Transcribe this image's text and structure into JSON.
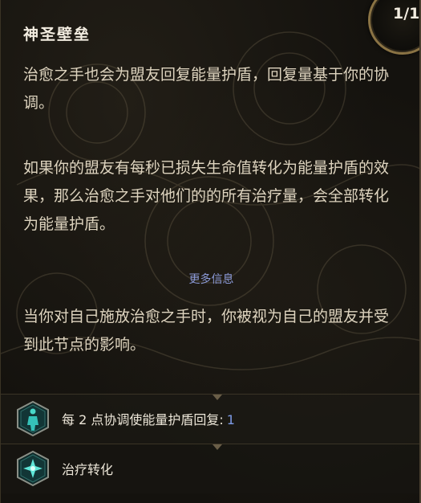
{
  "tooltip": {
    "title": "神圣壁垒",
    "rank": "1/1",
    "paragraph_1": "治愈之手也会为盟友回复能量护盾，回复量基于你的协调。",
    "paragraph_2": "如果你的盟友有每秒已损失生命值转化为能量护盾的效果，那么治愈之手对他们的的所有治疗量，会全部转化为能量护盾。",
    "more_info": "更多信息",
    "paragraph_3": "当你对自己施放治愈之手时，你被视为自己的盟友并受到此节点的影响。"
  },
  "modifiers": [
    {
      "label": "每 2 点协调使能量护盾回复:",
      "value": "1",
      "icon": "figure-hex-icon"
    },
    {
      "label": "治疗转化",
      "icon": "star-burst-hex-icon"
    }
  ],
  "colors": {
    "accent_link": "#8c9ad8",
    "value_blue": "#7d9ae6",
    "frame_gold": "#8a7344",
    "icon_teal": "#35c2b8"
  }
}
